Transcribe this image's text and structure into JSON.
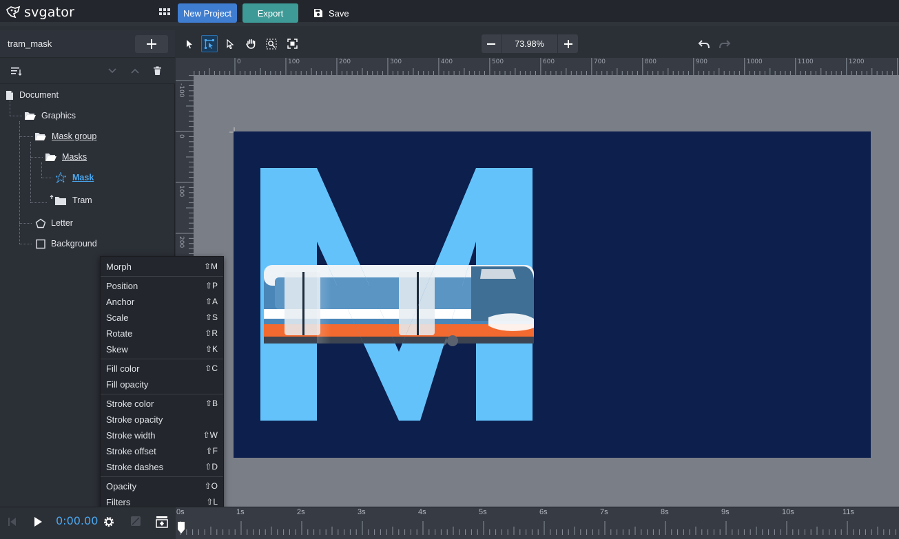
{
  "app": {
    "logo_text": "svgator",
    "new_project_label": "New Project",
    "export_label": "Export",
    "save_label": "Save",
    "accent_color": "#4aa8f0"
  },
  "project": {
    "name": "tram_mask"
  },
  "layers": [
    {
      "label": "Document",
      "icon": "document-icon",
      "depth": 0
    },
    {
      "label": "Graphics",
      "icon": "folder-open-icon",
      "depth": 1
    },
    {
      "label": "Mask group",
      "icon": "folder-open-icon",
      "depth": 2
    },
    {
      "label": "Masks",
      "icon": "folder-open-icon",
      "depth": 3
    },
    {
      "label": "Mask",
      "icon": "star-path-icon",
      "depth": 4,
      "selected": true
    },
    {
      "label": "Tram",
      "icon": "folder-icon",
      "depth": 3
    },
    {
      "label": "Letter",
      "icon": "pentagon-icon",
      "depth": 2
    },
    {
      "label": "Background",
      "icon": "square-icon",
      "depth": 2
    }
  ],
  "zoom": {
    "value": "73.98%"
  },
  "rulers": {
    "horizontal": [
      "0",
      "100",
      "200",
      "300",
      "400",
      "500",
      "600",
      "700",
      "800",
      "900",
      "1000",
      "1100",
      "1200"
    ],
    "vertical": [
      "-100",
      "0",
      "100",
      "200"
    ]
  },
  "context_menu": {
    "groups": [
      [
        {
          "label": "Morph",
          "shortcut": "⇧M"
        }
      ],
      [
        {
          "label": "Position",
          "shortcut": "⇧P"
        },
        {
          "label": "Anchor",
          "shortcut": "⇧A"
        },
        {
          "label": "Scale",
          "shortcut": "⇧S"
        },
        {
          "label": "Rotate",
          "shortcut": "⇧R"
        },
        {
          "label": "Skew",
          "shortcut": "⇧K"
        }
      ],
      [
        {
          "label": "Fill color",
          "shortcut": "⇧C"
        },
        {
          "label": "Fill opacity",
          "shortcut": ""
        }
      ],
      [
        {
          "label": "Stroke color",
          "shortcut": "⇧B"
        },
        {
          "label": "Stroke opacity",
          "shortcut": ""
        },
        {
          "label": "Stroke width",
          "shortcut": "⇧W"
        },
        {
          "label": "Stroke offset",
          "shortcut": "⇧F"
        },
        {
          "label": "Stroke dashes",
          "shortcut": "⇧D"
        }
      ],
      [
        {
          "label": "Opacity",
          "shortcut": "⇧O"
        },
        {
          "label": "Filters",
          "shortcut": "⇧L"
        }
      ]
    ]
  },
  "timeline": {
    "current_time": "0:00.00",
    "ticks": [
      "0s",
      "1s",
      "2s",
      "3s",
      "4s",
      "5s",
      "6s",
      "7s",
      "8s",
      "9s",
      "10s",
      "11s"
    ]
  }
}
